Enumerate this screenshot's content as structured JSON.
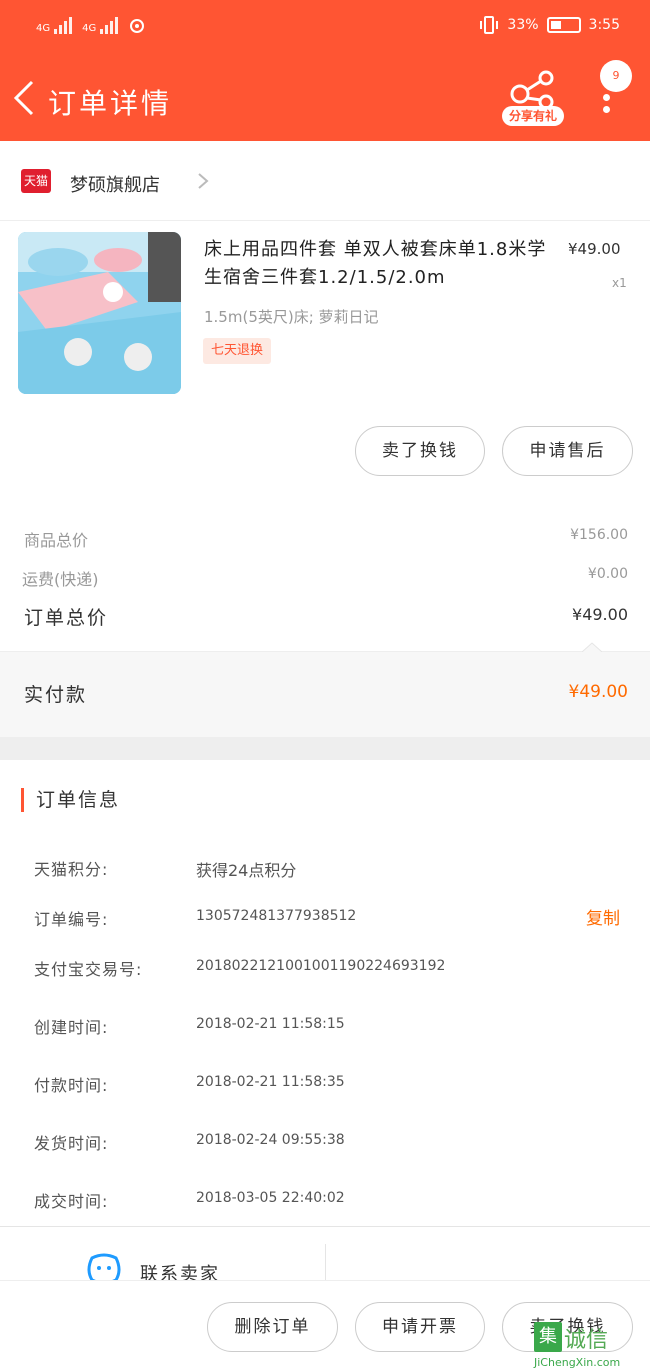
{
  "status_bar": {
    "sim1": "4G",
    "sim2": "4G",
    "battery": "33%",
    "time": "3:55"
  },
  "header": {
    "title": "订单详情",
    "share_label": "分享有礼",
    "badge_count": "9"
  },
  "shop": {
    "logo_text": "天猫",
    "name": "梦硕旗舰店"
  },
  "product": {
    "title": "床上用品四件套 单双人被套床单1.8米学生宿舍三件套1.2/1.5/2.0m",
    "sku": "1.5m(5英尺)床; 萝莉日记",
    "tag": "七天退换",
    "price": "¥49.00",
    "qty": "x1"
  },
  "actions": {
    "sell_label": "卖了换钱",
    "after_sale_label": "申请售后"
  },
  "summary": {
    "goods_total_label": "商品总价",
    "goods_total_value": "¥156.00",
    "shipping_label": "运费(快递)",
    "shipping_value": "¥0.00",
    "order_total_label": "订单总价",
    "order_total_value": "¥49.00",
    "paid_label": "实付款",
    "paid_value": "¥49.00"
  },
  "order_info": {
    "section_title": "订单信息",
    "copy_label": "复制",
    "rows": [
      {
        "label": "天猫积分:",
        "value": "获得24点积分"
      },
      {
        "label": "订单编号:",
        "value": "130572481377938512"
      },
      {
        "label": "支付宝交易号:",
        "value": "2018022121001001190224693192"
      },
      {
        "label": "创建时间:",
        "value": "2018-02-21  11:58:15"
      },
      {
        "label": "付款时间:",
        "value": "2018-02-21  11:58:35"
      },
      {
        "label": "发货时间:",
        "value": "2018-02-24  09:55:38"
      },
      {
        "label": "成交时间:",
        "value": "2018-03-05  22:40:02"
      }
    ]
  },
  "contact": {
    "label": "联系卖家"
  },
  "bottom_bar": {
    "delete_label": "删除订单",
    "invoice_label": "申请开票",
    "sell_label": "卖了换钱"
  },
  "watermark": {
    "badge": "集",
    "text": "诚信",
    "url": "JiChengXin.com"
  },
  "colors": {
    "header_bg": "#ff5533",
    "accent_orange": "#ff6a00",
    "tmall_red": "#e01f2f"
  }
}
